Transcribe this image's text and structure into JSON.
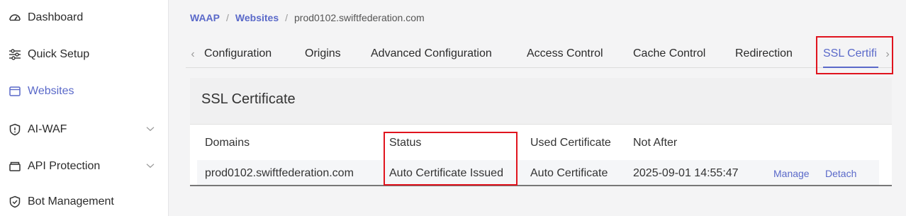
{
  "sidebar": {
    "items": [
      {
        "label": "Dashboard",
        "icon": "dashboard-icon"
      },
      {
        "label": "Quick Setup",
        "icon": "sliders-icon"
      },
      {
        "label": "Websites",
        "icon": "window-icon"
      },
      {
        "label": "AI-WAF",
        "icon": "shield-icon"
      },
      {
        "label": "API Protection",
        "icon": "folder-icon"
      },
      {
        "label": "Bot Management",
        "icon": "shield-icon"
      }
    ]
  },
  "breadcrumb": {
    "root": "WAAP",
    "section": "Websites",
    "current": "prod0102.swiftfederation.com",
    "separator": "/"
  },
  "tabs": {
    "prev_arrow": "‹",
    "next_arrow": "›",
    "items": [
      {
        "label": "Configuration"
      },
      {
        "label": "Origins"
      },
      {
        "label": "Advanced Configuration"
      },
      {
        "label": "Access Control"
      },
      {
        "label": "Cache Control"
      },
      {
        "label": "Redirection"
      },
      {
        "label": "SSL Certifi"
      }
    ]
  },
  "panel": {
    "title": "SSL Certificate"
  },
  "table": {
    "headers": [
      "Domains",
      "Status",
      "Used Certificate",
      "Not After"
    ],
    "rows": [
      {
        "domain": "prod0102.swiftfederation.com",
        "status": "Auto Certificate Issued",
        "used_certificate": "Auto Certificate",
        "not_after": "2025-09-01 14:55:47",
        "actions": [
          "Manage",
          "Detach"
        ]
      }
    ]
  },
  "colors": {
    "accent": "#5a69c9",
    "highlight_box": "#e0141e"
  }
}
